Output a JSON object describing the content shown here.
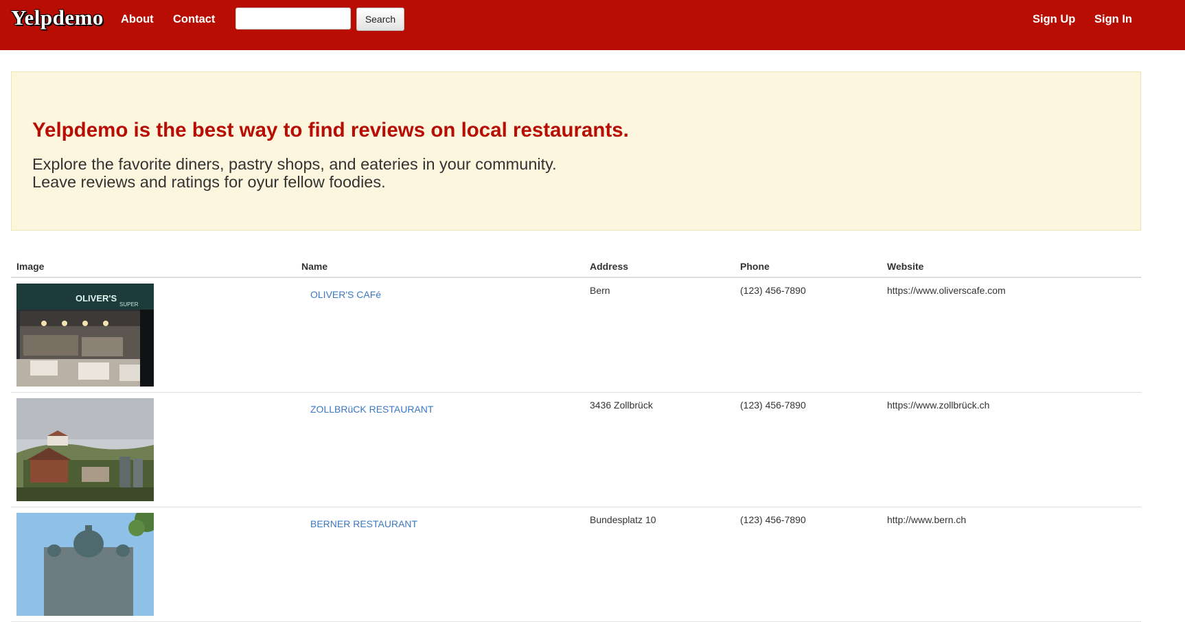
{
  "navbar": {
    "brand": "Yelpdemo",
    "links": [
      "About",
      "Contact"
    ],
    "search": {
      "value": "",
      "placeholder": "",
      "button_label": "Search"
    },
    "right_links": [
      "Sign Up",
      "Sign In"
    ],
    "colors": {
      "background": "#b70d03",
      "text": "#ffffff"
    }
  },
  "hero": {
    "title": "Yelpdemo is the best way to find reviews on local restaurants.",
    "line1": "Explore the favorite diners, pastry shops, and eateries in your community.",
    "line2": "Leave reviews and ratings for oyur fellow foodies."
  },
  "table": {
    "headers": [
      "Image",
      "Name",
      "Address",
      "Phone",
      "Website"
    ],
    "rows": [
      {
        "image": "cafe-storefront-photo",
        "name": "OLIVER'S CAFé",
        "address": "Bern",
        "phone": "(123) 456-7890",
        "website": "https://www.oliverscafe.com"
      },
      {
        "image": "village-landscape-photo",
        "name": "ZOLLBRüCK RESTAURANT",
        "address": "3436 Zollbrück",
        "phone": "(123) 456-7890",
        "website": "https://www.zollbrück.ch"
      },
      {
        "image": "parliament-building-photo",
        "name": "BERNER RESTAURANT",
        "address": "Bundesplatz 10",
        "phone": "(123) 456-7890",
        "website": "http://www.bern.ch"
      }
    ]
  }
}
